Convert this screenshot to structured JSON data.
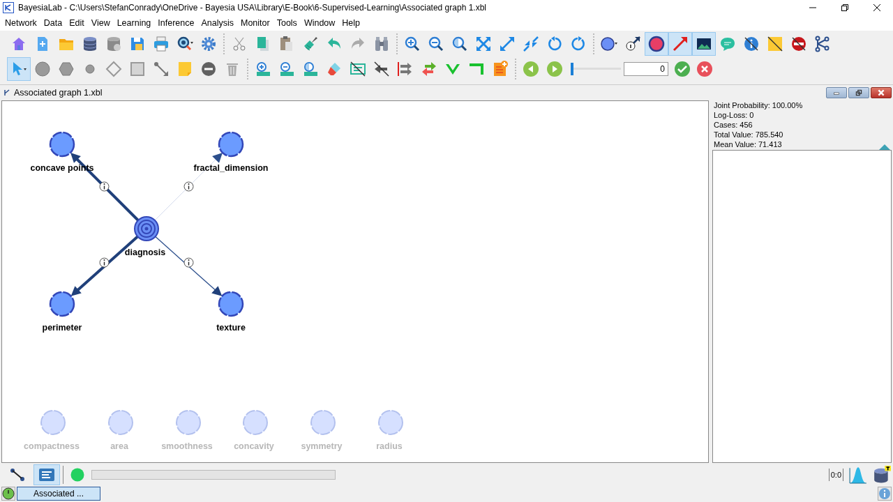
{
  "window": {
    "title": "BayesiaLab - C:\\Users\\StefanConrady\\OneDrive - Bayesia USA\\Library\\E-Book\\6-Supervised-Learning\\Associated graph 1.xbl"
  },
  "menu": [
    "Network",
    "Data",
    "Edit",
    "View",
    "Learning",
    "Inference",
    "Analysis",
    "Monitor",
    "Tools",
    "Window",
    "Help"
  ],
  "toolbar_1": [
    [
      {
        "selected": false
      },
      {
        "selected": false
      },
      {
        "selected": false
      },
      {
        "selected": false
      },
      {
        "selected": false
      },
      {
        "selected": false
      },
      {
        "selected": false
      },
      {
        "selected": false
      },
      {
        "selected": false
      }
    ],
    [
      {
        "selected": false
      },
      {
        "selected": false
      },
      {
        "selected": false
      },
      {
        "selected": false
      },
      {
        "selected": false
      },
      {
        "selected": false
      },
      {
        "selected": false
      }
    ],
    [
      {
        "selected": false
      },
      {
        "selected": false
      },
      {
        "selected": false
      },
      {
        "selected": false
      },
      {
        "selected": false
      },
      {
        "selected": false
      },
      {
        "selected": false
      },
      {
        "selected": false
      }
    ],
    [
      {
        "selected": false
      },
      {
        "selected": false
      },
      {
        "selected": true
      },
      {
        "selected": true
      },
      {
        "selected": true
      },
      {
        "selected": false
      },
      {
        "selected": false
      },
      {
        "selected": false
      },
      {
        "selected": false
      },
      {
        "selected": false
      }
    ]
  ],
  "toolbar_2": [
    [
      {
        "selected": true
      },
      {
        "selected": false
      },
      {
        "selected": false
      },
      {
        "selected": false
      },
      {
        "selected": false
      },
      {
        "selected": false
      },
      {
        "selected": false
      },
      {
        "selected": false
      },
      {
        "selected": false
      },
      {
        "selected": false
      }
    ],
    [
      {
        "selected": false
      },
      {
        "selected": false
      },
      {
        "selected": false
      },
      {
        "selected": false
      },
      {
        "selected": false
      },
      {
        "selected": false
      },
      {
        "selected": false
      },
      {
        "selected": false
      },
      {
        "selected": false
      },
      {
        "selected": false
      },
      {
        "selected": false
      }
    ],
    [
      {
        "selected": false
      },
      {
        "selected": false
      }
    ]
  ],
  "step_slider": {
    "level": 0
  },
  "step_field": {
    "value": "0"
  },
  "document": {
    "title": "Associated graph 1.xbl"
  },
  "graph": {
    "nodes": [
      {
        "label": "concave points",
        "kind": "node"
      },
      {
        "label": "fractal_dimension",
        "kind": "node"
      },
      {
        "label": "diagnosis",
        "kind": "target"
      },
      {
        "label": "perimeter",
        "kind": "node"
      },
      {
        "label": "texture",
        "kind": "node"
      },
      {
        "label": "compactness",
        "kind": "unlinked"
      },
      {
        "label": "area",
        "kind": "unlinked"
      },
      {
        "label": "smoothness",
        "kind": "unlinked"
      },
      {
        "label": "concavity",
        "kind": "unlinked"
      },
      {
        "label": "symmetry",
        "kind": "unlinked"
      },
      {
        "label": "radius",
        "kind": "unlinked"
      }
    ],
    "arcs": [
      {
        "kind": "strong"
      },
      {
        "kind": "weak"
      },
      {
        "kind": "strong"
      },
      {
        "kind": "medium"
      }
    ]
  },
  "stats": [
    "Joint Probability: 100.00%",
    "Log-Loss: 0",
    "Cases: 456",
    "Total Value: 785.540",
    "Mean Value: 71.413"
  ],
  "bottom": {
    "view_buttons": [
      {
        "kind": "graph",
        "selected": false
      },
      {
        "kind": "list",
        "selected": true
      }
    ],
    "progress": {
      "level": 0
    },
    "counter": "0:0"
  },
  "status_bar": {
    "task": {
      "label": "Associated ...",
      "selected": true
    }
  }
}
